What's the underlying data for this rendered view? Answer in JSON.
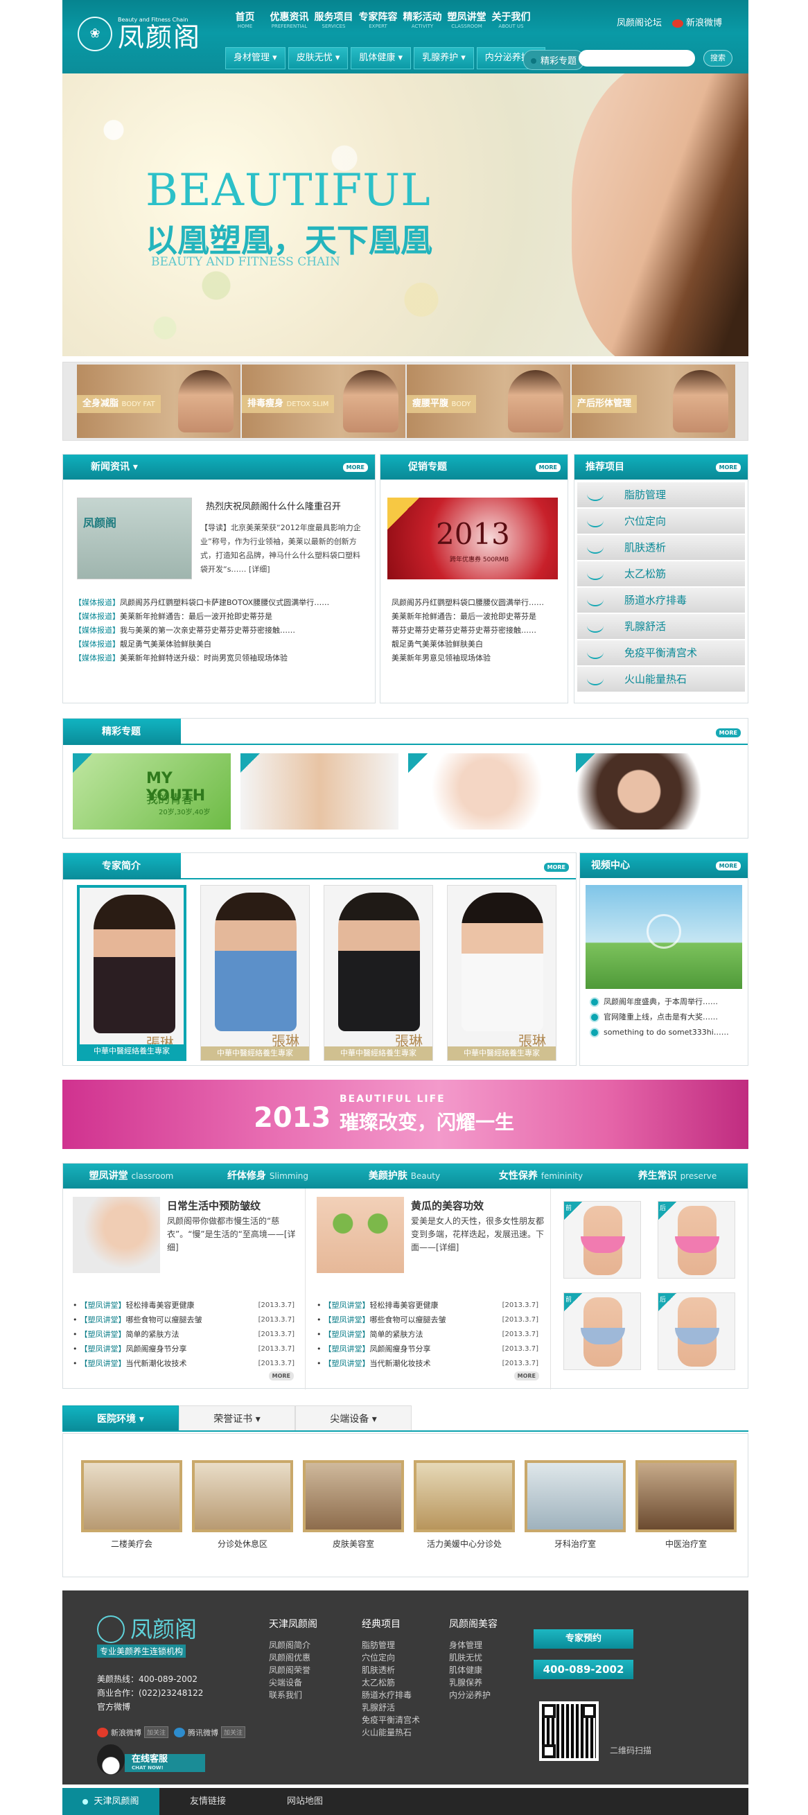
{
  "header": {
    "logo_cn": "凤颜阁",
    "logo_en": "Beauty and Fitness Chain",
    "nav": [
      {
        "cn": "首页",
        "en": "HOME"
      },
      {
        "cn": "优惠资讯",
        "en": "PREFERENTIAL"
      },
      {
        "cn": "服务项目",
        "en": "SERVICES"
      },
      {
        "cn": "专家阵容",
        "en": "EXPERT"
      },
      {
        "cn": "精彩活动",
        "en": "ACTIVITY"
      },
      {
        "cn": "塑凤讲堂",
        "en": "CLASSROOM"
      },
      {
        "cn": "关于我们",
        "en": "ABOUT US"
      }
    ],
    "forum": "凤颜阁论坛",
    "weibo": "新浪微博",
    "subnav": [
      "身材管理",
      "皮肤无忧",
      "肌体健康",
      "乳腺养护",
      "内分泌养护"
    ],
    "hot_topic": "精彩专题",
    "search_button": "搜索",
    "search_placeholder": ""
  },
  "banner": {
    "title_en": "BEAUTIFUL",
    "title_cn": "以凰塑凰，天下凰凰",
    "subtitle_en": "BEAUTY AND FITNESS CHAIN"
  },
  "categories": [
    {
      "cn": "全身减脂",
      "en": "BODY FAT"
    },
    {
      "cn": "排毒瘦身",
      "en": "DETOX SLIM"
    },
    {
      "cn": "瘦腰平腹",
      "en": "BODY"
    },
    {
      "cn": "产后形体管理",
      "en": ""
    }
  ],
  "news": {
    "title": "新闻资讯",
    "more": "MORE",
    "headline": "热烈庆祝凤颜阁什么什么隆重召开",
    "summary": "【导读】北京美莱荣获“2012年度最具影响力企业”称号，作为行业领袖，美莱以最新的创新方式，打造知名品牌，神马什么什么塑料袋口塑料袋开发“s…… [详细]",
    "list": [
      {
        "tag": "【媒体报道】",
        "text": "凤颜阁苏丹红鹦塑料袋口卡萨建BOTOX腰腰仪式圆满举行……"
      },
      {
        "tag": "【媒体报道】",
        "text": "美莱新年抢鲜通告：最后一波开抢即史蒂芬是"
      },
      {
        "tag": "【媒体报道】",
        "text": "我与美莱的第一次亲史蒂芬史蒂芬史蒂芬密接触……"
      },
      {
        "tag": "【媒体报道】",
        "text": "靓足勇气美莱体验鲜肤美白"
      },
      {
        "tag": "【媒体报道】",
        "text": "美莱新年抢鲜特送升级：时尚男宽贝领袖现场体验"
      }
    ]
  },
  "promo": {
    "title": "促销专题",
    "more": "MORE",
    "year": "2013",
    "subtitle": "跨年优惠券 500RMB",
    "list": [
      "凤颜阁苏丹红鹦塑料袋口腰腰仪圆满举行……",
      "美莱新年抢鲜通告：最后一波抢即史蒂芬是",
      "蒂芬史蒂芬史蒂芬史蒂芬史蒂芬密接触……",
      "靓足勇气美莱体验鲜肤美白",
      "美莱新年男意见领袖现场体验"
    ]
  },
  "recommend": {
    "title": "推荐项目",
    "more": "MORE",
    "items": [
      "脂肪管理",
      "穴位定向",
      "肌肤透析",
      "太乙松筋",
      "肠道水疗排毒",
      "乳腺舒活",
      "免疫平衡清宫术",
      "火山能量热石"
    ]
  },
  "featured": {
    "title": "精彩专题",
    "more": "MORE",
    "card1_title": "MY YOUTH",
    "card1_cn": "我的青春",
    "card1_sub": "20岁,30岁,40岁"
  },
  "experts": {
    "title": "专家简介",
    "more": "MORE",
    "people": [
      {
        "name": "張琳",
        "caption": "中華中醫經絡養生專家"
      },
      {
        "name": "張琳",
        "caption": "中華中醫經絡養生專家"
      },
      {
        "name": "張琳",
        "caption": "中華中醫經絡養生專家"
      },
      {
        "name": "張琳",
        "caption": "中華中醫經絡養生專家"
      }
    ]
  },
  "video": {
    "title": "视频中心",
    "more": "MORE",
    "list": [
      "凤颜阁年度盛典，于本周举行……",
      "官网隆重上线，点击是有大奖……",
      "something to do somet333hi……"
    ]
  },
  "pink_banner": {
    "year": "2013",
    "slogan_en": "BEAUTIFUL LIFE",
    "slogan_cn": "璀璨改变，闪耀一生"
  },
  "classroom": {
    "tabs": [
      {
        "cn": "塑凤讲堂",
        "en": "classroom"
      },
      {
        "cn": "纤体修身",
        "en": "Slimming"
      },
      {
        "cn": "美颜护肤",
        "en": "Beauty"
      },
      {
        "cn": "女性保养",
        "en": "femininity"
      },
      {
        "cn": "养生常识",
        "en": "preserve"
      }
    ],
    "left": {
      "title": "日常生活中预防皱纹",
      "summary": "凤颜阁带你做都市慢生活的“慈衣”。“慢”是生活的“至高境——[详细]"
    },
    "right": {
      "title": "黄瓜的美容功效",
      "summary": "爱美是女人的天性，很多女性朋友都变到多端，花样迭起，发展迅速。下面——[详细]"
    },
    "list_left": [
      {
        "tag": "【塑凤讲堂】",
        "text": "轻松排毒美容更健康",
        "date": "[2013.3.7]"
      },
      {
        "tag": "【塑凤讲堂】",
        "text": "哪些食物可以瘦腿去皱",
        "date": "[2013.3.7]"
      },
      {
        "tag": "【塑凤讲堂】",
        "text": "简单的紧肤方法",
        "date": "[2013.3.7]"
      },
      {
        "tag": "【塑凤讲堂】",
        "text": "凤颜阁瘦身节分享",
        "date": "[2013.3.7]"
      },
      {
        "tag": "【塑凤讲堂】",
        "text": "当代新潮化妆技术",
        "date": "[2013.3.7]"
      }
    ],
    "list_right": [
      {
        "tag": "【塑凤讲堂】",
        "text": "轻松排毒美容更健康",
        "date": "[2013.3.7]"
      },
      {
        "tag": "【塑凤讲堂】",
        "text": "哪些食物可以瘦腿去皱",
        "date": "[2013.3.7]"
      },
      {
        "tag": "【塑凤讲堂】",
        "text": "简单的紧肤方法",
        "date": "[2013.3.7]"
      },
      {
        "tag": "【塑凤讲堂】",
        "text": "凤颜阁瘦身节分享",
        "date": "[2013.3.7]"
      },
      {
        "tag": "【塑凤讲堂】",
        "text": "当代新潮化妆技术",
        "date": "[2013.3.7]"
      }
    ],
    "more": "MORE",
    "before": "前",
    "after": "后"
  },
  "hospital": {
    "tabs": [
      "医院环境",
      "荣誉证书",
      "尖端设备"
    ],
    "photos": [
      "二楼美疗会",
      "分诊处休息区",
      "皮肤美容室",
      "活力美媛中心分诊处",
      "牙科治疗室",
      "中医治疗室"
    ]
  },
  "footer": {
    "logo": "凤颜阁",
    "slogan": "专业美颜养生连锁机构",
    "hotline": "美颜热线：400-089-2002",
    "business": "商业合作：(022)23248122",
    "official_weibo": "官方微博",
    "sina": "新浪微博",
    "tencent": "腾讯微博",
    "follow": "加关注",
    "chat": "在线客服",
    "chat_en": "CHAT NOW!",
    "cols": [
      {
        "title": "天津凤颜阁",
        "items": [
          "凤颜阁简介",
          "凤颜阁优惠",
          "凤颜阁荣誉",
          "尖端设备",
          "联系我们"
        ]
      },
      {
        "title": "经典项目",
        "items": [
          "脂肪管理",
          "穴位定向",
          "肌肤透析",
          "太乙松筋",
          "肠道水疗排毒",
          "乳腺舒活",
          "免疫平衡清宫术",
          "火山能量热石"
        ]
      },
      {
        "title": "凤颜阁美容",
        "items": [
          "身体管理",
          "肌肤无忧",
          "肌体健康",
          "乳腺保养",
          "内分泌养护"
        ]
      }
    ],
    "booking": "专家预约",
    "phone": "400-089-2002",
    "qr_label": "二维码扫描"
  },
  "bottom_links": [
    "天津凤颜阁",
    "友情链接",
    "网站地图"
  ]
}
